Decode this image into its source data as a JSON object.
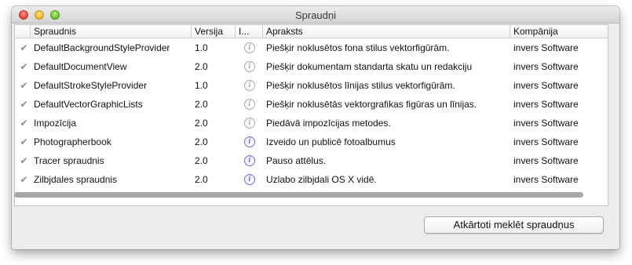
{
  "window": {
    "title": "Spraudņi"
  },
  "table": {
    "columns": {
      "name": "Spraudnis",
      "version": "Versija",
      "info": "I...",
      "description": "Apraksts",
      "company": "Kompānija"
    },
    "rows": [
      {
        "checked": true,
        "name": "DefaultBackgroundStyleProvider",
        "version": "1.0",
        "info_icon": "info-icon-grey",
        "description": "Piešķir noklusētos fona stilus vektorfigūrām.",
        "company": "invers Software"
      },
      {
        "checked": true,
        "name": "DefaultDocumentView",
        "version": "2.0",
        "info_icon": "info-icon-grey",
        "description": "Piešķir dokumentam standarta skatu un redakciju",
        "company": "invers Software"
      },
      {
        "checked": true,
        "name": "DefaultStrokeStyleProvider",
        "version": "1.0",
        "info_icon": "info-icon-grey",
        "description": "Piešķir noklusētos līnijas stilus vektorfigūrām.",
        "company": "invers Software"
      },
      {
        "checked": true,
        "name": "DefaultVectorGraphicLists",
        "version": "2.0",
        "info_icon": "info-icon-grey",
        "description": "Piešķir noklusētās vektorgrafikas figūras un līnijas.",
        "company": "invers Software"
      },
      {
        "checked": true,
        "name": "Impozīcija",
        "version": "2.0",
        "info_icon": "info-icon-grey",
        "description": "Piedāvā impozīcijas metodes.",
        "company": "invers Software"
      },
      {
        "checked": true,
        "name": "Photographerbook",
        "version": "2.0",
        "info_icon": "info-icon-blue",
        "description": "Izveido un publicē fotoalbumus",
        "company": "invers Software"
      },
      {
        "checked": true,
        "name": "Tracer spraudnis",
        "version": "2.0",
        "info_icon": "info-icon-blue",
        "description": "Pauso attēlus.",
        "company": "invers Software"
      },
      {
        "checked": true,
        "name": "Zilbjdales spraudnis",
        "version": "2.0",
        "info_icon": "info-icon-blue",
        "description": "Uzlabo zilbjdali OS X vidē.",
        "company": "invers Software"
      }
    ]
  },
  "buttons": {
    "rescan": "Atkārtoti meklēt spraudņus"
  },
  "icons": {
    "check": "checkmark-icon",
    "info": "info-icon"
  },
  "colors": {
    "info_blue": "#4848b8",
    "info_grey": "#8a8a8a",
    "check_grey": "#8a8a8a"
  }
}
